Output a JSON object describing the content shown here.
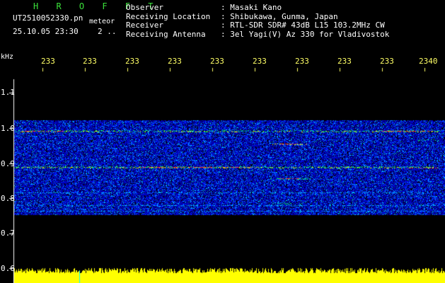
{
  "header": {
    "title": "H R O F F T",
    "filename": "UT2510052330.pn",
    "mode": "meteor",
    "datetime": "25.10.05 23:30",
    "count": "2 .."
  },
  "meta": [
    {
      "key": "Observer",
      "value": ": Masaki Kano"
    },
    {
      "key": "Receiving Location",
      "value": ": Shibukawa, Gunma, Japan"
    },
    {
      "key": "Receiver",
      "value": ": RTL-SDR SDR# 43dB L15 103.2MHz CW"
    },
    {
      "key": "Receiving Antenna",
      "value": ": 3el Yagi(V) Az 330 for Vladivostok"
    }
  ],
  "y_unit": "kHz",
  "y_ticks": [
    {
      "label": "1.1",
      "value": 1.1
    },
    {
      "label": "1.0",
      "value": 1.0
    },
    {
      "label": "0.9",
      "value": 0.9
    },
    {
      "label": "0.8",
      "value": 0.8
    },
    {
      "label": "0.7",
      "value": 0.7
    },
    {
      "label": "0.6",
      "value": 0.6
    }
  ],
  "x_ticks": [
    "233",
    "233",
    "233",
    "233",
    "233",
    "233",
    "233",
    "233",
    "233",
    "2340"
  ],
  "colors": {
    "title": "#3be23b",
    "tick_x": "#ffff66",
    "baseline": "#ffff00"
  }
}
